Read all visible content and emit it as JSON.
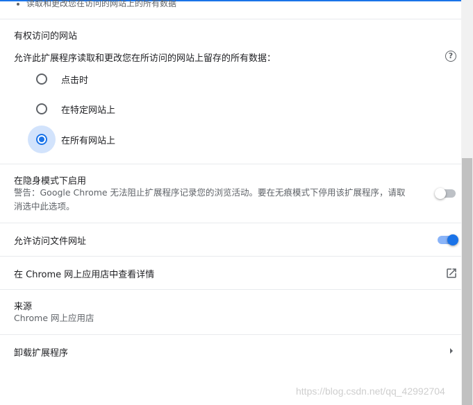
{
  "cutoff_text": "读取和更改您在访问的网站上的所有数据",
  "site_access": {
    "title": "有权访问的网站",
    "description": "允许此扩展程序读取和更改您在所访问的网站上留存的所有数据：",
    "help_glyph": "?",
    "options": [
      {
        "label": "点击时",
        "checked": false
      },
      {
        "label": "在特定网站上",
        "checked": false
      },
      {
        "label": "在所有网站上",
        "checked": true
      }
    ]
  },
  "incognito": {
    "title": "在隐身模式下启用",
    "warning_line1": "警告：Google Chrome 无法阻止扩展程序记录您的浏览活动。要在无痕模式下停用该扩展程序，请取",
    "warning_line2": "消选中此选项。",
    "enabled": false
  },
  "file_urls": {
    "title": "允许访问文件网址",
    "enabled": true
  },
  "store_link": {
    "label": "在 Chrome 网上应用店中查看详情",
    "icon": "open-in-new-icon"
  },
  "source": {
    "title": "来源",
    "value": "Chrome 网上应用店"
  },
  "uninstall": {
    "label": "卸载扩展程序",
    "icon": "chevron-right-icon"
  },
  "watermark": "https://blog.csdn.net/qq_42992704",
  "colors": {
    "accent": "#1a73e8",
    "accent_light": "#8ab4f8",
    "halo": "#d2e3fc",
    "text": "#202124",
    "secondary_text": "#5f6368",
    "divider": "#e8eaed"
  }
}
